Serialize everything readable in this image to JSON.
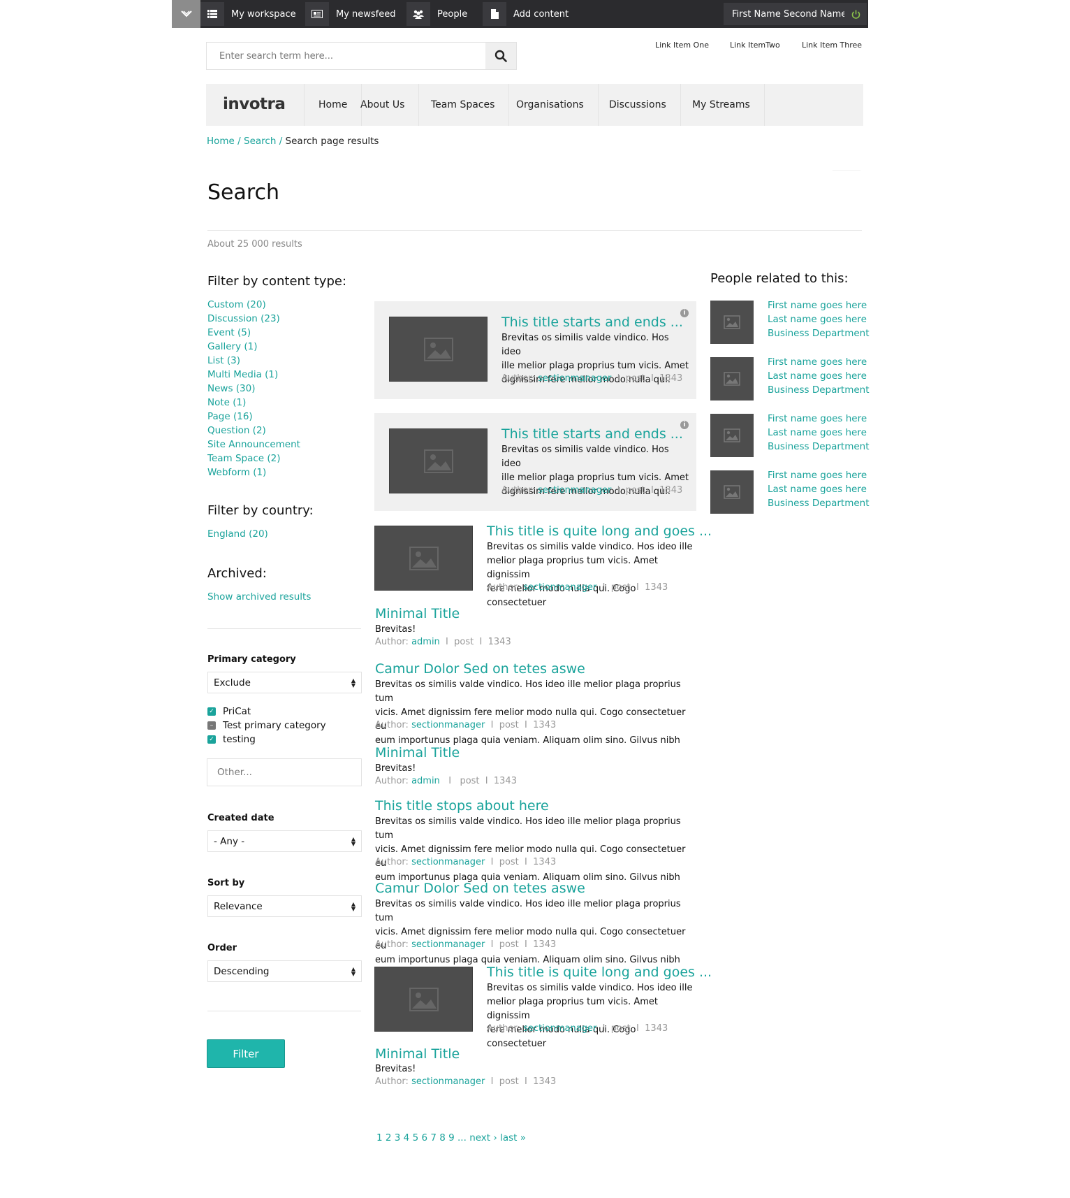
{
  "topbar": {
    "items": [
      {
        "label": "My workspace",
        "icon": "list-icon"
      },
      {
        "label": "My newsfeed",
        "icon": "newsfeed-icon"
      },
      {
        "label": "People",
        "icon": "people-icon"
      },
      {
        "label": "Add content",
        "icon": "document-icon"
      }
    ],
    "user_name": "First Name Second Name"
  },
  "search": {
    "placeholder": "Enter search term here..."
  },
  "top_links": [
    "Link Item One",
    "Link ItemTwo",
    "Link Item Three"
  ],
  "brand": {
    "logo": "invotra"
  },
  "nav": [
    "Home",
    "About Us",
    "Team Spaces",
    "Organisations",
    "Discussions",
    "My Streams"
  ],
  "breadcrumb": {
    "home": "Home",
    "search": "Search",
    "sep": " / ",
    "current": "Search page results"
  },
  "page_title": "Search",
  "results_count": "About 25 000 results",
  "filters": {
    "content_type_heading": "Filter by content type:",
    "content_types": [
      "Custom (20)",
      "Discussion (23)",
      "Event (5)",
      "Gallery (1)",
      "List (3)",
      "Multi Media (1)",
      "News (30)",
      "Note (1)",
      "Page (16)",
      "Question (2)",
      "Site Announcement",
      "Team Space (2)",
      "Webform (1)"
    ],
    "country_heading": "Filter by country:",
    "countries": [
      "England (20)"
    ],
    "archived_heading": "Archived:",
    "archived_link": "Show archived results",
    "primary_category_label": "Primary category",
    "primary_category_value": "Exclude",
    "categories": [
      {
        "label": "PriCat",
        "state": "checked"
      },
      {
        "label": "Test primary category",
        "state": "partial"
      },
      {
        "label": "testing",
        "state": "checked"
      }
    ],
    "other_placeholder": "Other...",
    "created_date_label": "Created date",
    "created_date_value": "- Any -",
    "sort_by_label": "Sort by",
    "sort_by_value": "Relevance",
    "order_label": "Order",
    "order_value": "Descending",
    "filter_button": "Filter"
  },
  "results": [
    {
      "title": "This title starts and ends ...",
      "body": [
        "Brevitas os similis valde vindico. Hos ideo",
        "ille melior plaga proprius tum vicis. Amet",
        "dignissim fere melior modo nulla qui."
      ],
      "author": "sectionmanager",
      "type": "post",
      "count": "1343"
    },
    {
      "title": "This title starts and ends ...",
      "body": [
        "Brevitas os similis valde vindico. Hos ideo",
        "ille melior plaga proprius tum vicis. Amet",
        "dignissim fere melior modo nulla qui."
      ],
      "author": "sectionmanager",
      "type": "post",
      "count": "1343"
    },
    {
      "title": "This title is quite long and goes ...",
      "body": [
        "Brevitas os similis valde vindico. Hos ideo ille",
        "melior plaga proprius tum vicis. Amet dignissim",
        "fere melior modo nulla qui. Cogo consectetuer"
      ],
      "author": "sectionmanager",
      "type": "post",
      "count": "1343"
    },
    {
      "title": "Minimal Title",
      "body": [
        "Brevitas!"
      ],
      "author": "admin",
      "type": "post",
      "count": "1343"
    },
    {
      "title": "Camur Dolor Sed on tetes aswe",
      "body": [
        "Brevitas os similis valde vindico. Hos ideo ille melior plaga proprius tum",
        "vicis. Amet dignissim fere melior modo nulla qui. Cogo consectetuer eu",
        "eum importunus plaga quia veniam. Aliquam olim sino. Gilvus nibh"
      ],
      "author": "sectionmanager",
      "type": "post",
      "count": "1343"
    },
    {
      "title": "Minimal Title",
      "body": [
        "Brevitas!"
      ],
      "author": "admin",
      "type": "post",
      "count": "1343"
    },
    {
      "title": "This title stops about here",
      "body": [
        "Brevitas os similis valde vindico. Hos ideo ille melior plaga proprius tum",
        "vicis. Amet dignissim fere melior modo nulla qui. Cogo consectetuer eu",
        "eum importunus plaga quia veniam. Aliquam olim sino. Gilvus nibh"
      ],
      "author": "sectionmanager",
      "type": "post",
      "count": "1343"
    },
    {
      "title": "Camur Dolor Sed on tetes aswe",
      "body": [
        "Brevitas os similis valde vindico. Hos ideo ille melior plaga proprius tum",
        "vicis. Amet dignissim fere melior modo nulla qui. Cogo consectetuer eu",
        "eum importunus plaga quia veniam. Aliquam olim sino. Gilvus nibh"
      ],
      "author": "sectionmanager",
      "type": "post",
      "count": "1343"
    },
    {
      "title": "This title is quite long and goes ...",
      "body": [
        "Brevitas os similis valde vindico. Hos ideo ille",
        "melior plaga proprius tum vicis. Amet dignissim",
        "fere melior modo nulla qui. Cogo consectetuer"
      ],
      "author": "sectionmanager",
      "type": "post",
      "count": "1343"
    },
    {
      "title": "Minimal Title",
      "body": [
        "Brevitas!"
      ],
      "author": "sectionmanager",
      "type": "post",
      "count": "1343"
    }
  ],
  "author_prefix": "Author:",
  "people": {
    "heading": "People related to this:",
    "entries": [
      {
        "first": "First name goes here",
        "last": "Last name goes here",
        "dept": "Business Department"
      },
      {
        "first": "First name goes here",
        "last": "Last name goes here",
        "dept": "Business Department"
      },
      {
        "first": "First name goes here",
        "last": "Last name goes here",
        "dept": "Business Department"
      },
      {
        "first": "First name goes here",
        "last": "Last name goes here",
        "dept": "Business Department"
      }
    ]
  },
  "pager": {
    "pages": [
      "1",
      "2",
      "3",
      "4",
      "5",
      "6",
      "7",
      "8",
      "9"
    ],
    "ellipsis": "...",
    "next": "next ›",
    "last": "last",
    "last_icon": "»"
  },
  "colors": {
    "accent": "#1aa39b",
    "topbar": "#2b2b2e",
    "power": "#8bc34a"
  }
}
